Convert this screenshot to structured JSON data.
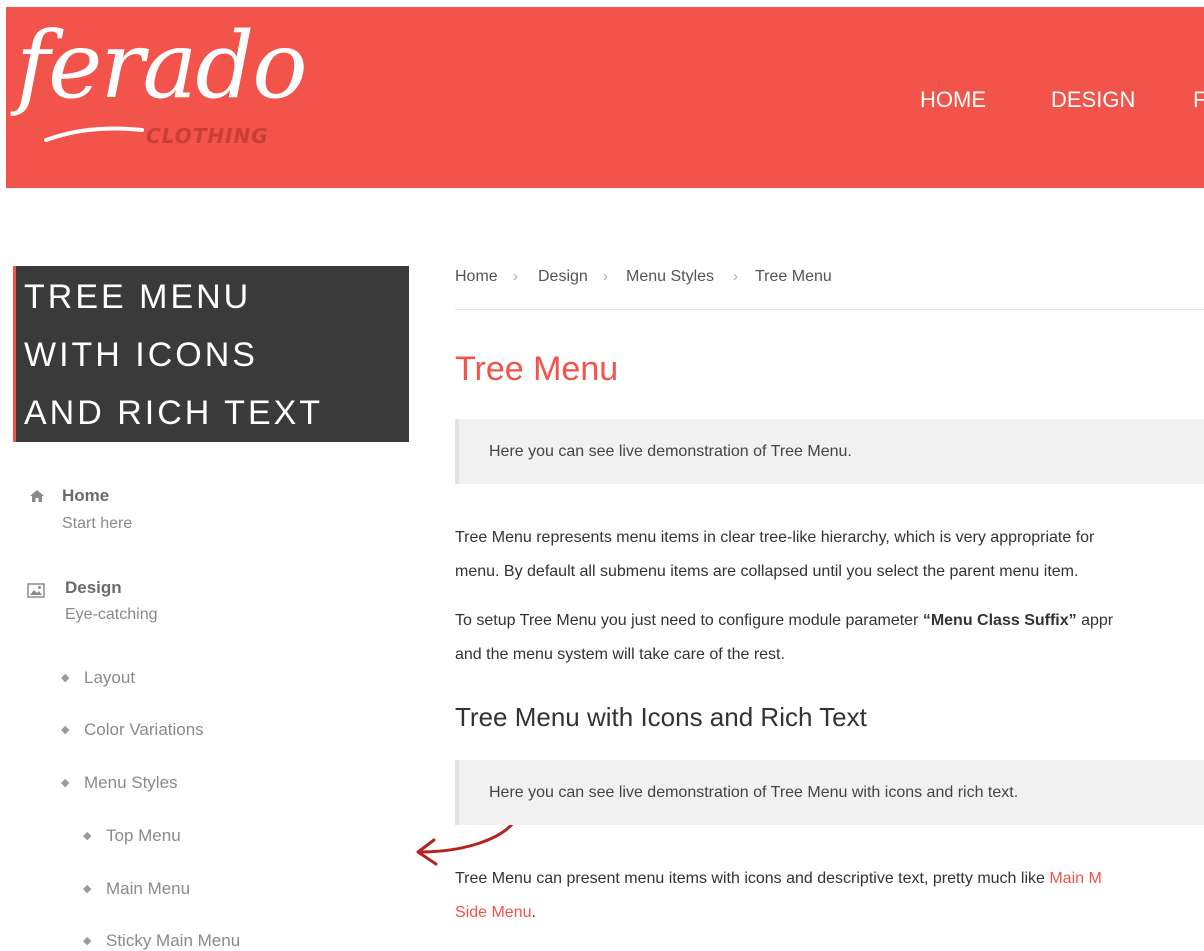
{
  "header": {
    "logo_word": "ferado",
    "logo_sub": "CLOTHING",
    "nav": [
      "HOME",
      "DESIGN",
      "F"
    ]
  },
  "sidebar": {
    "title_lines": [
      "TREE MENU",
      "WITH ICONS",
      "AND RICH TEXT"
    ],
    "items": [
      {
        "icon": "home-icon",
        "title": "Home",
        "desc": "Start here"
      },
      {
        "icon": "image-icon",
        "title": "Design",
        "desc": "Eye-catching"
      }
    ],
    "sub_items": [
      "Layout",
      "Color Variations",
      "Menu Styles"
    ],
    "sub_sub_items": [
      "Top Menu",
      "Main Menu",
      "Sticky Main Menu"
    ]
  },
  "breadcrumb": [
    "Home",
    "Design",
    "Menu Styles",
    "Tree Menu"
  ],
  "content": {
    "title": "Tree Menu",
    "notice1": "Here you can see live demonstration of Tree Menu.",
    "para1_line1": "Tree Menu represents menu items in clear tree-like hierarchy, which is very appropriate for",
    "para1_line2": "menu. By default all submenu items are collapsed until you select the parent menu item.",
    "para2_line1_pre": "To setup Tree Menu you just need to configure module parameter ",
    "para2_line1_bold": "“Menu Class Suffix”",
    "para2_line1_post": " appr",
    "para2_line2": "and the menu system will take care of the rest.",
    "subtitle": "Tree Menu with Icons and Rich Text",
    "notice2": "Here you can see live demonstration of Tree Menu with icons and rich text.",
    "para3_line1_pre": "Tree Menu can present menu items with icons and descriptive text, pretty much like ",
    "para3_line1_link": "Main M",
    "para3_line2_link": "Side Menu",
    "para3_line2_post": "."
  },
  "colors": {
    "brand": "#f2534a",
    "sidebar_title_bg": "#3a3a3a",
    "notice_bg": "#f1f1f1",
    "annotation_arrow": "#b3231f"
  }
}
